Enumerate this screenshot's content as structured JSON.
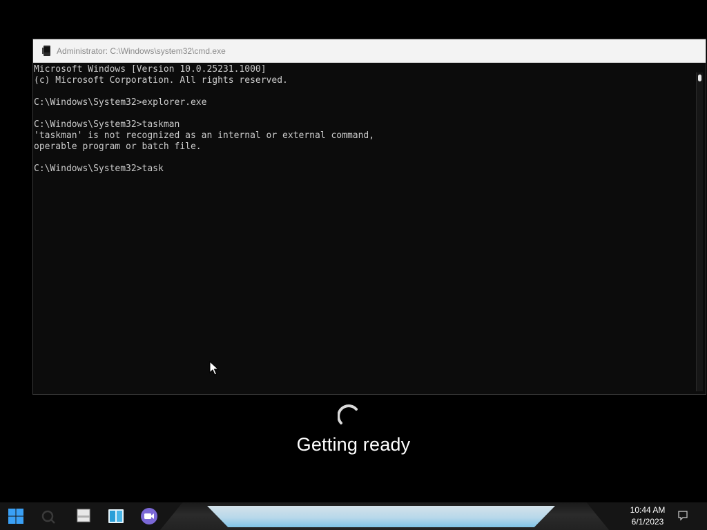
{
  "window": {
    "title": "Administrator: C:\\Windows\\system32\\cmd.exe",
    "icon": "cmd-icon",
    "background": "#0c0c0c",
    "text_color": "#cccccc"
  },
  "console": {
    "lines": [
      "Microsoft Windows [Version 10.0.25231.1000]",
      "(c) Microsoft Corporation. All rights reserved.",
      "",
      "C:\\Windows\\System32>explorer.exe",
      "",
      "C:\\Windows\\System32>taskman",
      "'taskman' is not recognized as an internal or external command,",
      "operable program or batch file.",
      "",
      "C:\\Windows\\System32>task"
    ]
  },
  "overlay": {
    "status_text": "Getting ready",
    "spinner_icon": "loading-spinner-icon"
  },
  "taskbar": {
    "items": [
      {
        "name": "start-button",
        "icon": "windows-logo-icon"
      },
      {
        "name": "search-button",
        "icon": "search-icon"
      },
      {
        "name": "file-explorer-button",
        "icon": "folder-icon"
      },
      {
        "name": "widgets-button",
        "icon": "widgets-icon"
      },
      {
        "name": "teams-chat-button",
        "icon": "video-chat-icon"
      }
    ],
    "clock": {
      "time": "10:44 AM",
      "date": "6/1/2023"
    },
    "notification_icon": "notification-icon"
  },
  "colors": {
    "desktop": "#000000",
    "taskbar": "#151515",
    "accent": "#3aa0f5"
  }
}
